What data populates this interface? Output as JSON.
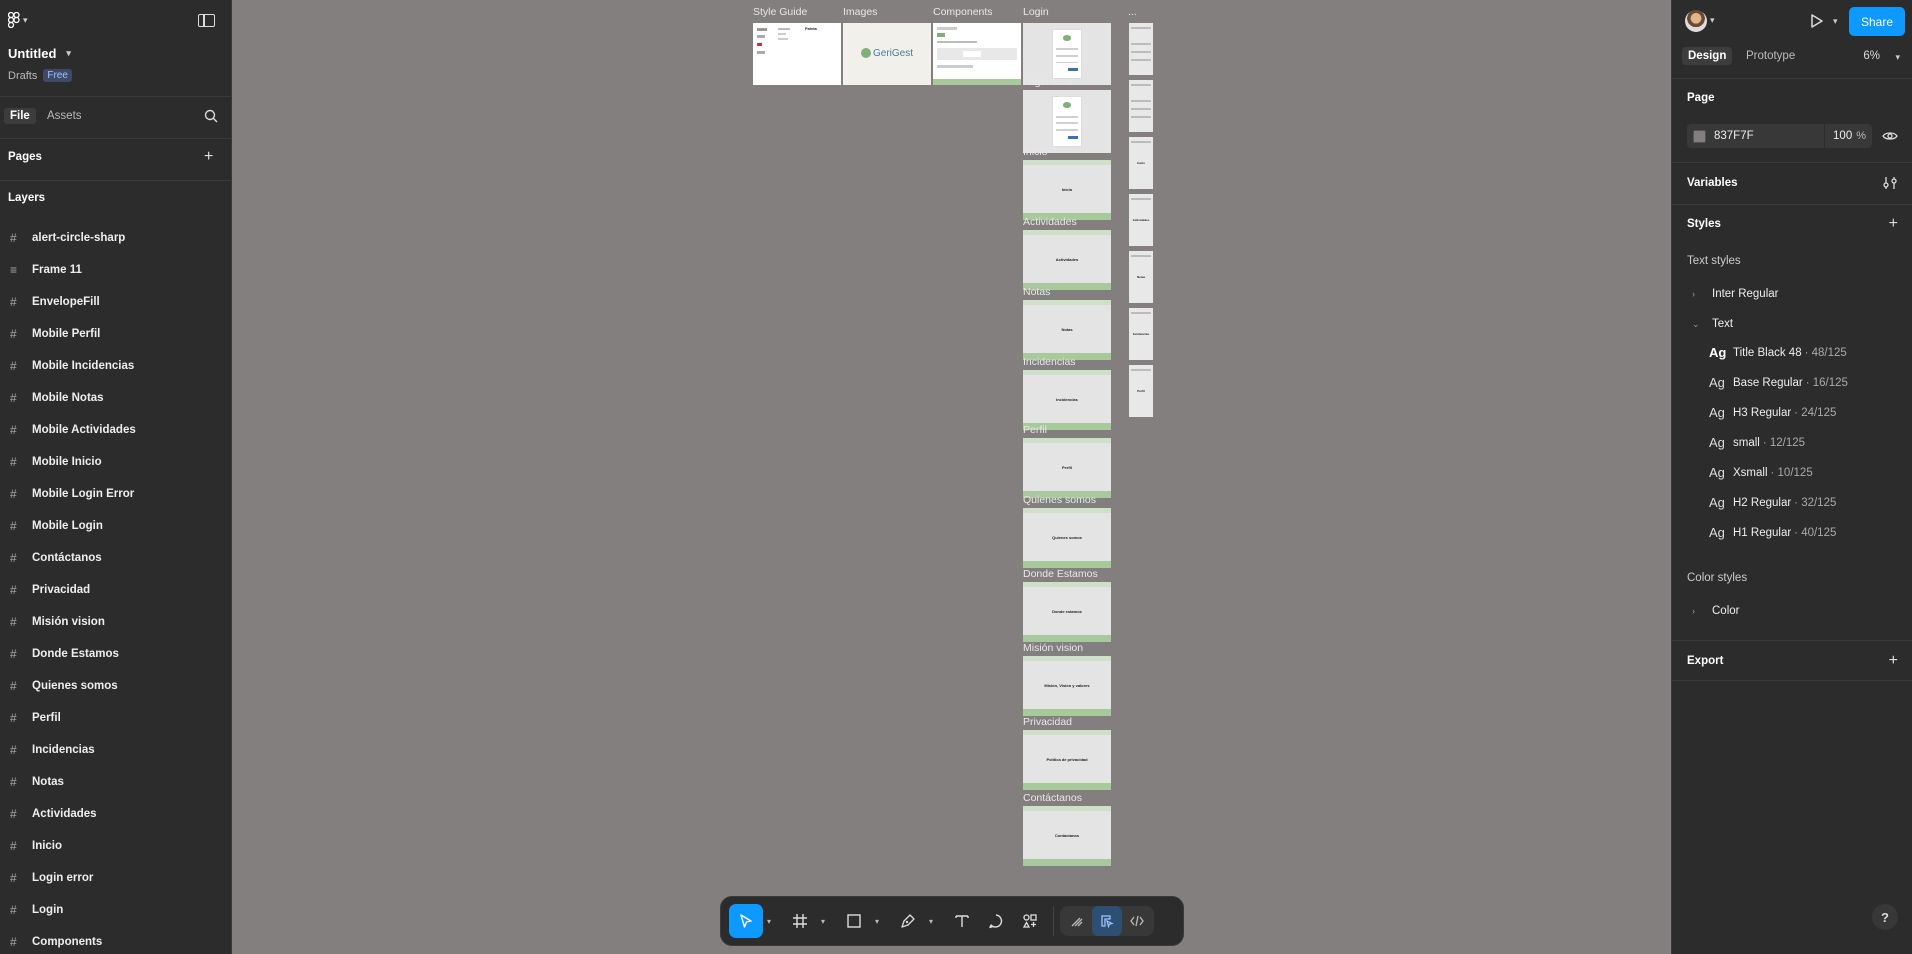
{
  "app": {
    "file_title": "Untitled",
    "location": "Drafts",
    "plan_badge": "Free"
  },
  "left_panel": {
    "tabs": [
      "File",
      "Assets"
    ],
    "pages_label": "Pages",
    "layers_label": "Layers",
    "layers": [
      {
        "label": "alert-circle-sharp",
        "icon": "frame-icon"
      },
      {
        "label": "Frame 11",
        "icon": "autolayout-icon"
      },
      {
        "label": "EnvelopeFill",
        "icon": "frame-icon"
      },
      {
        "label": "Mobile Perfil",
        "icon": "frame-icon"
      },
      {
        "label": "Mobile Incidencias",
        "icon": "frame-icon"
      },
      {
        "label": "Mobile Notas",
        "icon": "frame-icon"
      },
      {
        "label": "Mobile Actividades",
        "icon": "frame-icon"
      },
      {
        "label": "Mobile Inicio",
        "icon": "frame-icon"
      },
      {
        "label": "Mobile Login Error",
        "icon": "frame-icon"
      },
      {
        "label": "Mobile Login",
        "icon": "frame-icon"
      },
      {
        "label": "Contáctanos",
        "icon": "frame-icon"
      },
      {
        "label": "Privacidad",
        "icon": "frame-icon"
      },
      {
        "label": "Misión vision",
        "icon": "frame-icon"
      },
      {
        "label": "Donde Estamos",
        "icon": "frame-icon"
      },
      {
        "label": "Quienes somos",
        "icon": "frame-icon"
      },
      {
        "label": "Perfil",
        "icon": "frame-icon"
      },
      {
        "label": "Incidencias",
        "icon": "frame-icon"
      },
      {
        "label": "Notas",
        "icon": "frame-icon"
      },
      {
        "label": "Actividades",
        "icon": "frame-icon"
      },
      {
        "label": "Inicio",
        "icon": "frame-icon"
      },
      {
        "label": "Login error",
        "icon": "frame-icon"
      },
      {
        "label": "Login",
        "icon": "frame-icon"
      },
      {
        "label": "Components",
        "icon": "frame-icon"
      }
    ]
  },
  "canvas": {
    "background": "#837F7F",
    "top_frames": [
      "Style Guide",
      "Images",
      "Components",
      "Login",
      "..."
    ],
    "images_logo_text": "GeriGest",
    "style_guide_text": "Paleta",
    "column_frames": [
      {
        "label": "Login error",
        "center_text": ""
      },
      {
        "label": "Inicio",
        "center_text": "Inicio"
      },
      {
        "label": "Actividades",
        "center_text": "Actividades"
      },
      {
        "label": "Notas",
        "center_text": "Notas"
      },
      {
        "label": "Incidencias",
        "center_text": "Incidencias"
      },
      {
        "label": "Perfil",
        "center_text": "Perfil"
      },
      {
        "label": "Quienes somos",
        "center_text": "Quienes somos"
      },
      {
        "label": "Donde Estamos",
        "center_text": "Donde estamos"
      },
      {
        "label": "Misión vision",
        "center_text": "Misión, Visión y valores"
      },
      {
        "label": "Privacidad",
        "center_text": "Política de privacidad"
      },
      {
        "label": "Contáctanos",
        "center_text": "Contáctanos"
      }
    ],
    "mobile_frames": [
      "",
      "",
      "Inicio",
      "Actividades",
      "Notas",
      "Incidencias",
      "Perfil"
    ]
  },
  "toolbar": {
    "tools": [
      "move-tool",
      "frame-tool",
      "shape-tool",
      "pen-tool",
      "text-tool",
      "comment-tool",
      "actions-tool"
    ],
    "modes": [
      "draw-mode",
      "design-mode",
      "dev-mode"
    ]
  },
  "right_panel": {
    "share_label": "Share",
    "tabs": [
      "Design",
      "Prototype"
    ],
    "zoom": "6%",
    "page_label": "Page",
    "page_color": "837F7F",
    "page_opacity": "100",
    "page_opacity_unit": "%",
    "variables_label": "Variables",
    "styles_label": "Styles",
    "text_styles_label": "Text styles",
    "text_style_groups": [
      "Inter Regular",
      "Text"
    ],
    "text_styles": [
      {
        "name": "Title Black 48",
        "meta": "· 48/125"
      },
      {
        "name": "Base Regular",
        "meta": "· 16/125"
      },
      {
        "name": "H3 Regular",
        "meta": "· 24/125"
      },
      {
        "name": "small",
        "meta": "· 12/125"
      },
      {
        "name": "Xsmall",
        "meta": "· 10/125"
      },
      {
        "name": "H2 Regular",
        "meta": "· 32/125"
      },
      {
        "name": "H1 Regular",
        "meta": "· 40/125"
      }
    ],
    "text_style_glyph": "Ag",
    "color_styles_label": "Color styles",
    "color_group": "Color",
    "export_label": "Export",
    "help_label": "?"
  }
}
